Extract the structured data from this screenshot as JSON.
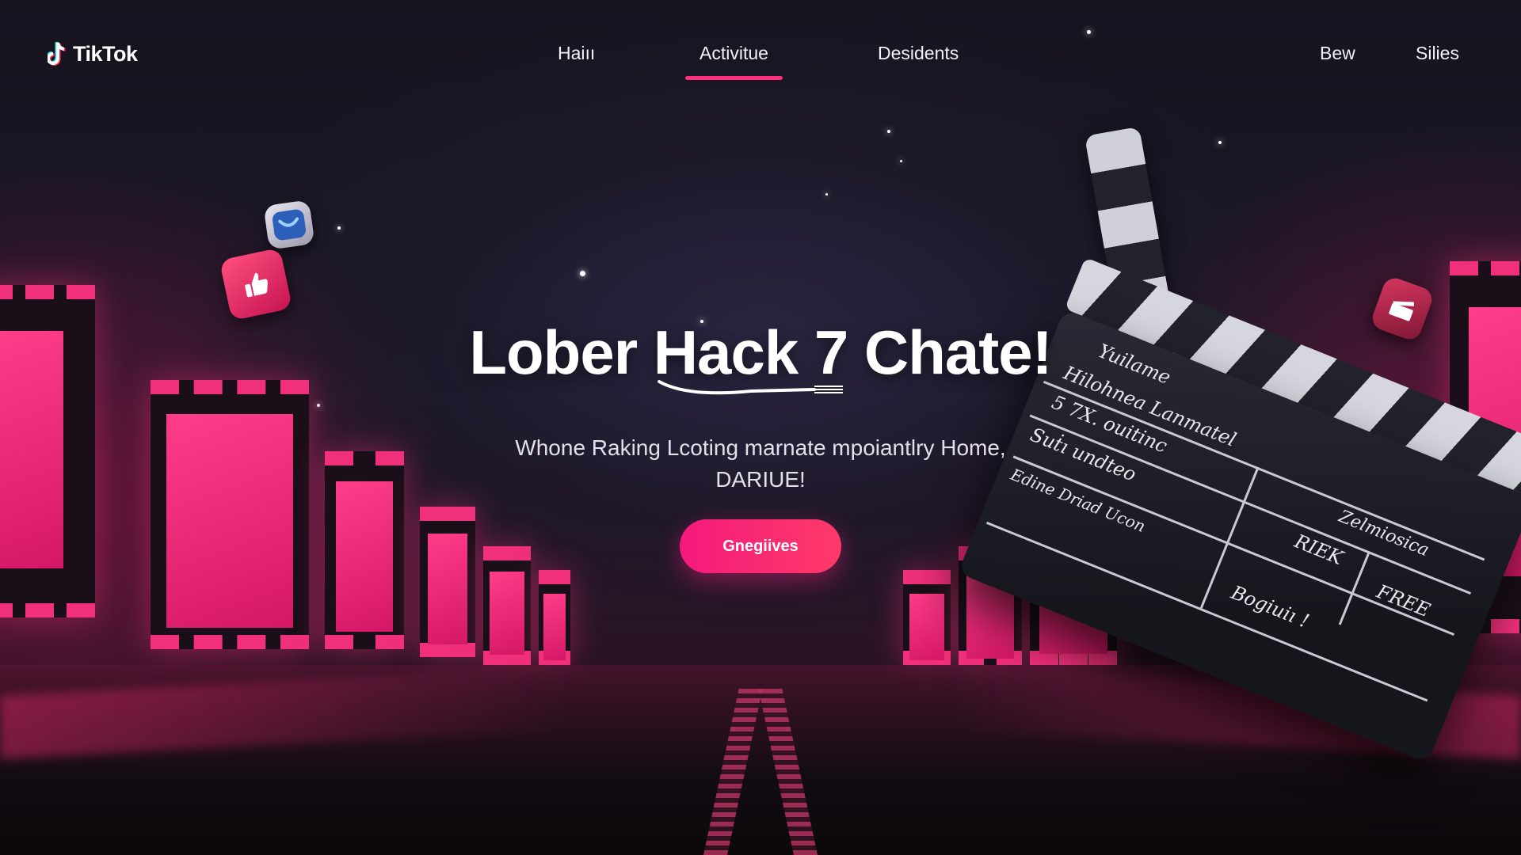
{
  "brand": {
    "name": "TikTok",
    "logo_icon": "tiktok-note-icon",
    "accent": "#ff2f7d"
  },
  "nav": {
    "items": [
      {
        "label": "Haiıı",
        "active": false
      },
      {
        "label": "Activitue",
        "active": true
      },
      {
        "label": "Desidents",
        "active": false
      },
      {
        "label": "Bew",
        "active": false
      },
      {
        "label": "Silies",
        "active": false
      }
    ]
  },
  "hero": {
    "title": "Lober Hack 7 Chate!",
    "subtitle_line1": "Whone Raking Lcoting marnate mpoiantlry Home,",
    "subtitle_line2": "DARIUE!",
    "cta_label": "Gnegiives"
  },
  "floating_icons": [
    "thumbs-up-icon",
    "chat-bubble-icon",
    "small-gift-icon",
    "clapper-mini-icon"
  ],
  "clapperboard": {
    "lines": [
      "Yuilame",
      "Hilohnea Lanmatel",
      "5 7X. ouitinc",
      "Suṫı undteo",
      "Edine Driad Ucon",
      "Zelmiosica",
      "RIEK",
      "FREE",
      "Bogiuiı !"
    ]
  },
  "colors": {
    "pink": "#f0307a",
    "background": "#151321",
    "cta_start": "#f41a7d",
    "cta_end": "#ff3a68"
  }
}
